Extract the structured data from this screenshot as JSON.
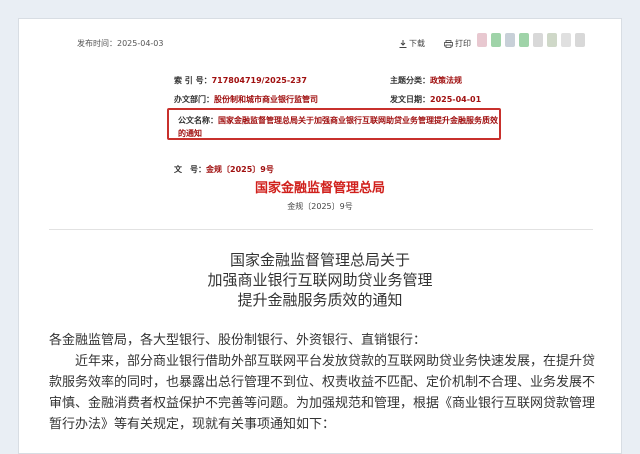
{
  "topbar": {
    "publish_date": "发布时间：2025-04-03",
    "download_label": "下载",
    "print_label": "打印",
    "download_icon": "download-icon",
    "print_icon": "printer-icon"
  },
  "meta": {
    "index_label": "索 引 号：",
    "index_value": "717804719/2025-237",
    "topic_label": "主题分类：",
    "topic_value": "政策法规",
    "office_label": "办文部门：",
    "office_value": "股份制和城市商业银行监管司",
    "date_label": "发文日期：",
    "date_value": "2025-04-01",
    "title_label": "公文名称：",
    "title_value": "国家金融监督管理总局关于加强商业银行互联网助贷业务管理提升金融服务质效的通知",
    "docno_label": "文　号：",
    "docno_value": "金规〔2025〕9号"
  },
  "document": {
    "issuer": "国家金融监督管理总局",
    "docno": "金规〔2025〕9号",
    "heading_lines": [
      "国家金融监督管理总局关于",
      "加强商业银行互联网助贷业务管理",
      "提升金融服务质效的通知"
    ],
    "salutation": "各金融监管局，各大型银行、股份制银行、外资银行、直销银行：",
    "paragraph1": "近年来，部分商业银行借助外部互联网平台发放贷款的互联网助贷业务快速发展，在提升贷款服务效率的同时，也暴露出总行管理不到位、权责收益不匹配、定价机制不合理、业务发展不审慎、金融消费者权益保护不完善等问题。为加强规范和管理，根据《商业银行互联网贷款管理暂行办法》等有关规定，现就有关事项通知如下："
  },
  "colors": {
    "accent_red": "#d0201c",
    "value_red": "#a01010",
    "highlight_border": "#c8302c"
  }
}
